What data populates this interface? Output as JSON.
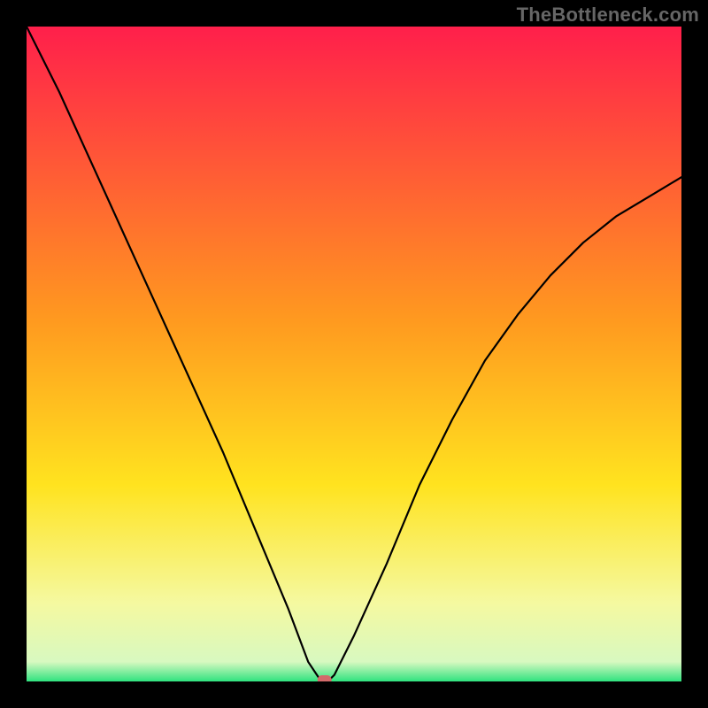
{
  "watermark": "TheBottleneck.com",
  "chart_data": {
    "type": "line",
    "title": "",
    "xlabel": "",
    "ylabel": "",
    "xlim": [
      0,
      100
    ],
    "ylim": [
      0,
      100
    ],
    "grid": false,
    "legend": false,
    "background_gradient_stops": [
      {
        "offset": 0,
        "color": "#ff1f4b"
      },
      {
        "offset": 0.45,
        "color": "#ff9a1f"
      },
      {
        "offset": 0.7,
        "color": "#ffe31f"
      },
      {
        "offset": 0.88,
        "color": "#f5f9a0"
      },
      {
        "offset": 0.97,
        "color": "#d8f9c0"
      },
      {
        "offset": 1.0,
        "color": "#2fe37f"
      }
    ],
    "series": [
      {
        "name": "bottleneck-curve",
        "color": "#000000",
        "x": [
          0,
          5,
          10,
          15,
          20,
          25,
          30,
          35,
          40,
          43,
          45,
          46,
          47,
          50,
          55,
          60,
          65,
          70,
          75,
          80,
          85,
          90,
          95,
          100
        ],
        "values": [
          100,
          90,
          79,
          68,
          57,
          46,
          35,
          23,
          11,
          3,
          0,
          0,
          1,
          7,
          18,
          30,
          40,
          49,
          56,
          62,
          67,
          71,
          74,
          77
        ]
      }
    ],
    "annotations": [
      {
        "name": "min-marker",
        "x": 45.5,
        "y": 0,
        "shape": "pill",
        "color": "#d36a6a"
      }
    ]
  }
}
